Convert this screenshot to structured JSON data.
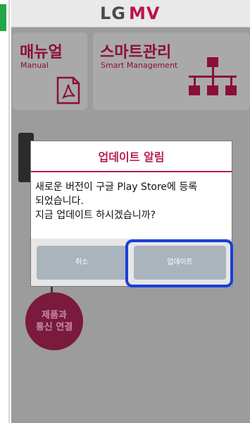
{
  "header": {
    "logo_lg": "LG",
    "logo_mv": "MV"
  },
  "tiles": {
    "manual": {
      "title": "매뉴얼",
      "subtitle": "Manual",
      "icon": "pdf-document-icon"
    },
    "smart": {
      "title": "스마트관리",
      "subtitle": "Smart Management",
      "icon": "network-hierarchy-icon"
    }
  },
  "connect_button": {
    "line1": "제품과",
    "line2": "통신 연결"
  },
  "dialog": {
    "title": "업데이트 알림",
    "message_line1": "새로운 버전이 구글 Play Store에 등록",
    "message_line2": "되었습니다.",
    "message_line3": "지금 업데이트 하시겠습니까?",
    "cancel_label": "취소",
    "update_label": "업데이트"
  },
  "colors": {
    "accent": "#b81d55",
    "highlight": "#1a3fd8",
    "status_green": "#22a64a"
  }
}
